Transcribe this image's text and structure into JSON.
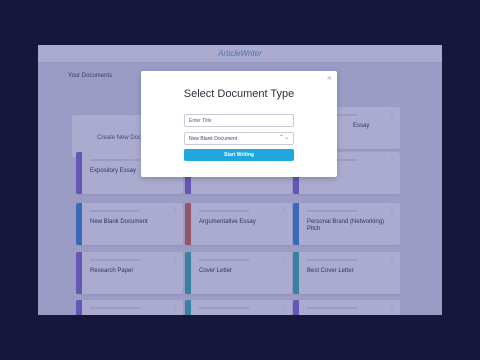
{
  "app": {
    "logo": "ArticleWriter",
    "section_title": "Your Documents",
    "create_label": "Create New Doc"
  },
  "cards": [
    {
      "title": "Expository Essay",
      "color": "#8a6fce"
    },
    {
      "title": "",
      "color": "#8a6fce"
    },
    {
      "title": "Essay",
      "color": "#8a6fce"
    },
    {
      "title": "New Blank Document",
      "color": "#3b8fd8"
    },
    {
      "title": "Argumentative Essay",
      "color": "#d46f4d"
    },
    {
      "title": "Personal Brand (Networking) Pitch",
      "color": "#3b8fd8"
    },
    {
      "title": "Research Paper",
      "color": "#8a6fce"
    },
    {
      "title": "Cover Letter",
      "color": "#3fb7b0"
    },
    {
      "title": "Best Cover Letter",
      "color": "#3fb7b0"
    },
    {
      "title": "",
      "color": "#8a6fce"
    },
    {
      "title": "",
      "color": "#3fb7b0"
    },
    {
      "title": "",
      "color": "#8a6fce"
    }
  ],
  "top_card": {
    "title": "Essay"
  },
  "modal": {
    "close_glyph": "×",
    "title": "Select Document Type",
    "title_placeholder": "Enter Title",
    "doc_type_value": "New Blank Document",
    "select_chevron": "⌃⌄",
    "start_label": "Start Writing"
  },
  "colors": {
    "overlay": "#34388c",
    "accent": "#1fa7e0"
  }
}
